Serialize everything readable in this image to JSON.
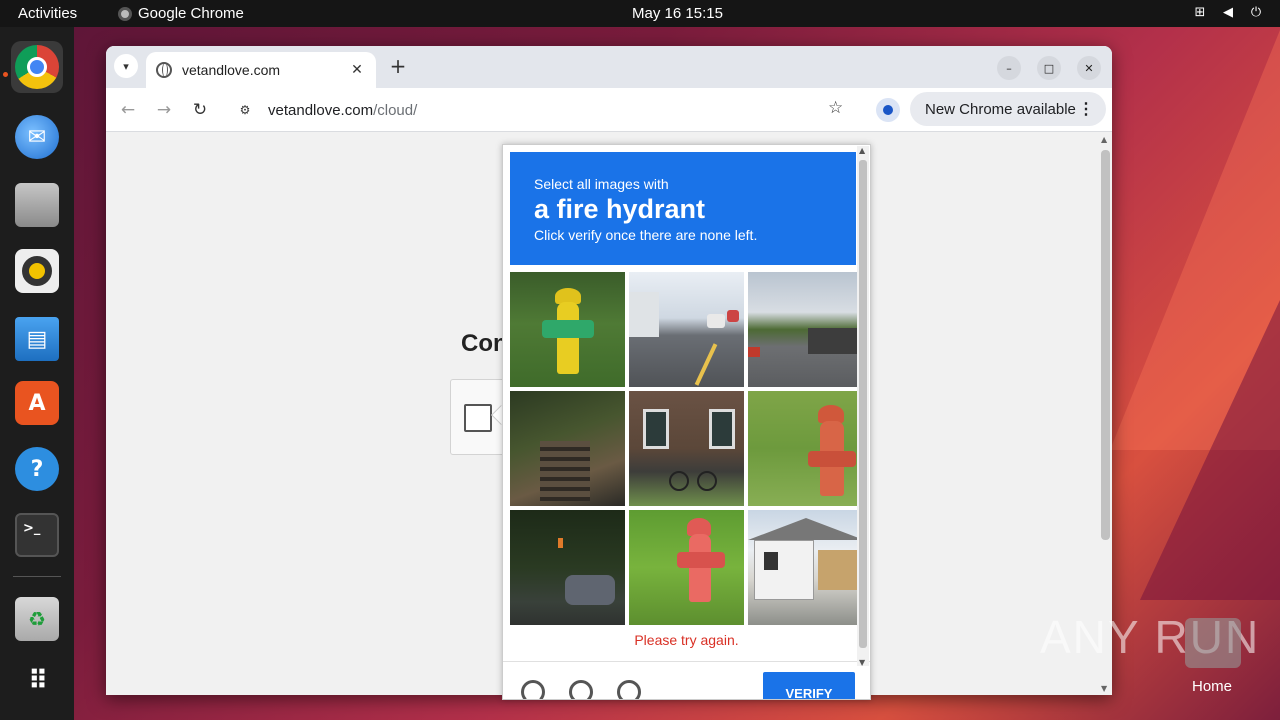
{
  "topbar": {
    "activities": "Activities",
    "app_name": "Google Chrome",
    "clock": "May 16  15:15"
  },
  "dock": {
    "items": [
      {
        "name": "chrome-icon",
        "color": "#db4437"
      },
      {
        "name": "thunderbird-icon",
        "color": "#1f6fd1"
      },
      {
        "name": "files-icon",
        "color": "#9a9a9a"
      },
      {
        "name": "rhythmbox-icon",
        "color": "#f2c200"
      },
      {
        "name": "writer-icon",
        "color": "#1e88e5"
      },
      {
        "name": "app-center-icon",
        "color": "#e95420"
      },
      {
        "name": "help-icon",
        "color": "#2d8ee0"
      },
      {
        "name": "terminal-icon",
        "color": "#333333"
      },
      {
        "name": "trash-icon",
        "color": "#c0c0c0"
      },
      {
        "name": "app-grid-icon",
        "color": "#ffffff"
      }
    ]
  },
  "browser": {
    "tab_title": "vetandlove.com",
    "url_host": "vetandlove.com",
    "url_path": "/cloud/",
    "update_chip": "New Chrome available"
  },
  "page": {
    "heading": "Con"
  },
  "captcha": {
    "prompt_sub": "Select all images with",
    "prompt_main": "a fire hydrant",
    "prompt_hint": "Click verify once there are none left.",
    "error": "Please try again.",
    "verify": "VERIFY",
    "accent": "#1a73e8",
    "error_color": "#d93025"
  },
  "watermark": {
    "text": "ANY RUN",
    "home": "Home"
  }
}
